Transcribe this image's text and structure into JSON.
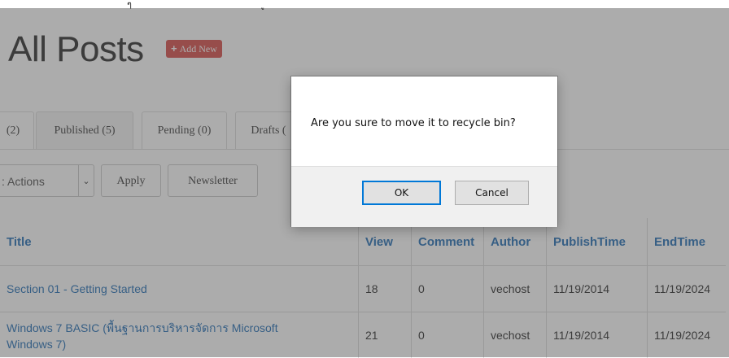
{
  "top_fragment": {
    "left": "ๆ",
    "right": "ู"
  },
  "page": {
    "title": "All Posts",
    "add_new_label": "Add New"
  },
  "tabs": [
    {
      "label": "(2)"
    },
    {
      "label": "Published (5)"
    },
    {
      "label": "Pending (0)"
    },
    {
      "label": "Drafts ("
    }
  ],
  "actions": {
    "bulk_select_value": ": Actions",
    "apply_label": "Apply",
    "newsletter_label": "Newsletter"
  },
  "table": {
    "headers": [
      "Title",
      "View",
      "Comment",
      "Author",
      "PublishTime",
      "EndTime"
    ],
    "rows": [
      {
        "title": "Section 01 - Getting Started",
        "view": "18",
        "comment": "0",
        "author": "vechost",
        "publish": "11/19/2014",
        "end": "11/19/2024"
      },
      {
        "title_line1": "Windows 7 BASIC (พื้นฐานการบริหารจัดการ Microsoft",
        "title_line2": "Windows 7)",
        "view": "21",
        "comment": "0",
        "author": "vechost",
        "publish": "11/19/2014",
        "end": "11/19/2024"
      }
    ]
  },
  "dialog": {
    "message": "Are you sure to move it to recycle bin?",
    "ok_label": "OK",
    "cancel_label": "Cancel"
  },
  "colors": {
    "link": "#2a73b8",
    "add_new": "#d9534f",
    "overlay": "rgba(70,70,70,0.45)"
  }
}
